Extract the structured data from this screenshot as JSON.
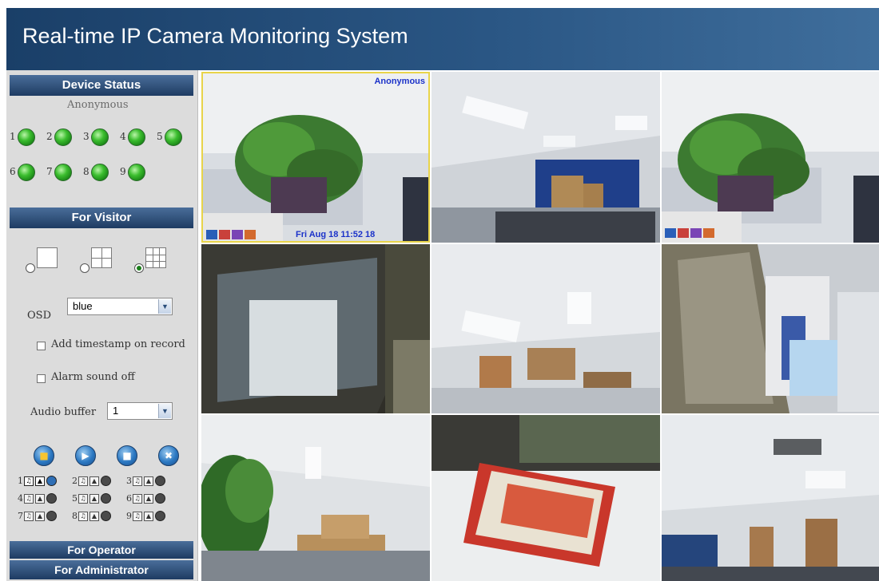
{
  "header": {
    "title": "Real-time IP Camera Monitoring System"
  },
  "sidebar": {
    "device_status": {
      "title": "Device Status",
      "user": "Anonymous",
      "devices": [
        "1",
        "2",
        "3",
        "4",
        "5",
        "6",
        "7",
        "8",
        "9"
      ]
    },
    "visitor": {
      "title": "For Visitor",
      "layout_options": [
        "1-view",
        "4-view",
        "9-view"
      ],
      "layout_selected": "9-view",
      "osd_label": "OSD",
      "osd_value": "blue",
      "timestamp_label": "Add timestamp on record",
      "alarm_label": "Alarm sound off",
      "audio_label": "Audio buffer",
      "audio_value": "1",
      "channels": [
        "1",
        "2",
        "3",
        "4",
        "5",
        "6",
        "7",
        "8",
        "9"
      ]
    },
    "operator": {
      "title": "For Operator"
    },
    "administrator": {
      "title": "For Administrator"
    }
  },
  "video": {
    "overlay_user": "Anonymous",
    "overlay_time": "Fri Aug 18 11:52 18",
    "camera_count": 9
  },
  "colors": {
    "header": "#2a5684",
    "section_bar": "#1e3b62",
    "led_green": "#3bbd2e",
    "osd_blue": "#1b32c9"
  },
  "icons": {
    "record": "folder-icon",
    "play": "play-icon",
    "stop": "stop-icon",
    "trash": "trash-icon"
  }
}
